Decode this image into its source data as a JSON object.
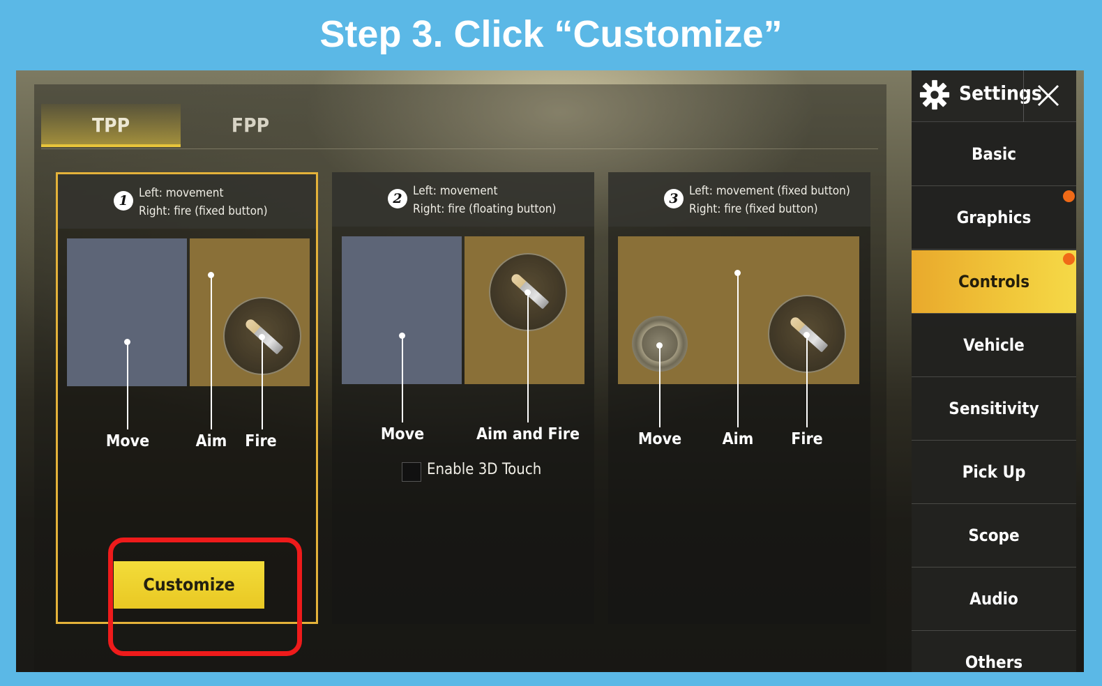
{
  "banner": {
    "title": "Step 3. Click “Customize”"
  },
  "tabs": [
    {
      "label": "TPP",
      "selected": true
    },
    {
      "label": "FPP",
      "selected": false
    }
  ],
  "layouts": [
    {
      "number": "1",
      "desc_line1": "Left: movement",
      "desc_line2": "Right: fire (fixed button)",
      "labels": [
        "Move",
        "Aim",
        "Fire"
      ],
      "selected": true,
      "customize_label": "Customize"
    },
    {
      "number": "2",
      "desc_line1": "Left: movement",
      "desc_line2": "Right: fire (floating button)",
      "labels": [
        "Move",
        "Aim and Fire"
      ],
      "checkbox_label": "Enable 3D Touch",
      "checkbox_checked": false
    },
    {
      "number": "3",
      "desc_line1": "Left: movement (fixed button)",
      "desc_line2": "Right: fire (fixed button)",
      "labels": [
        "Move",
        "Aim",
        "Fire"
      ]
    }
  ],
  "sidebar": {
    "title": "Settings",
    "items": [
      {
        "label": "Basic",
        "active": false,
        "notify": false
      },
      {
        "label": "Graphics",
        "active": false,
        "notify": true
      },
      {
        "label": "Controls",
        "active": true,
        "notify": true
      },
      {
        "label": "Vehicle",
        "active": false,
        "notify": false
      },
      {
        "label": "Sensitivity",
        "active": false,
        "notify": false
      },
      {
        "label": "Pick Up",
        "active": false,
        "notify": false
      },
      {
        "label": "Scope",
        "active": false,
        "notify": false
      },
      {
        "label": "Audio",
        "active": false,
        "notify": false
      },
      {
        "label": "Others",
        "active": false,
        "notify": false
      }
    ]
  },
  "colors": {
    "background": "#5bb8e6",
    "accent": "#e9c823",
    "highlight": "#ee1b1b",
    "notify": "#f06a17"
  }
}
